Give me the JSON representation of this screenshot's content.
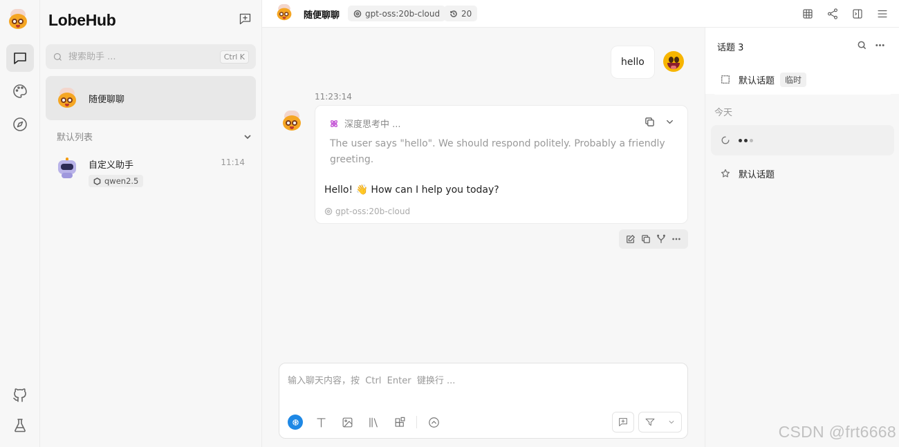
{
  "app": {
    "brand": "LobeHub"
  },
  "search": {
    "placeholder": "搜索助手 ...",
    "shortcut": "Ctrl  K"
  },
  "sessions": {
    "active": {
      "title": "随便聊聊"
    },
    "group": {
      "label": "默认列表"
    },
    "items": [
      {
        "title": "自定义助手",
        "time": "11:14",
        "model": "qwen2.5"
      }
    ]
  },
  "header": {
    "title": "随便聊聊",
    "model": "gpt-oss:20b-cloud",
    "history_count": "20"
  },
  "chat": {
    "user_message": "hello",
    "timestamp": "11:23:14",
    "thinking_label": "深度思考中 ...",
    "thinking_text": "The user says \"hello\". We should respond politely. Probably a friendly greeting.",
    "reply": "Hello! 👋 How can I help you today?",
    "model_footer": "gpt-oss:20b-cloud"
  },
  "input": {
    "placeholder": "输入聊天内容，按  Ctrl  Enter  键换行 ..."
  },
  "topics": {
    "header": "话题 3",
    "pinned": {
      "title": "默认话题",
      "tag": "临时"
    },
    "day_label": "今天",
    "items": [
      {
        "title": "默认话题"
      }
    ]
  },
  "watermark": "CSDN @frt6668",
  "colors": {
    "accent": "#1e88e5",
    "thinking": "#c456d6"
  }
}
